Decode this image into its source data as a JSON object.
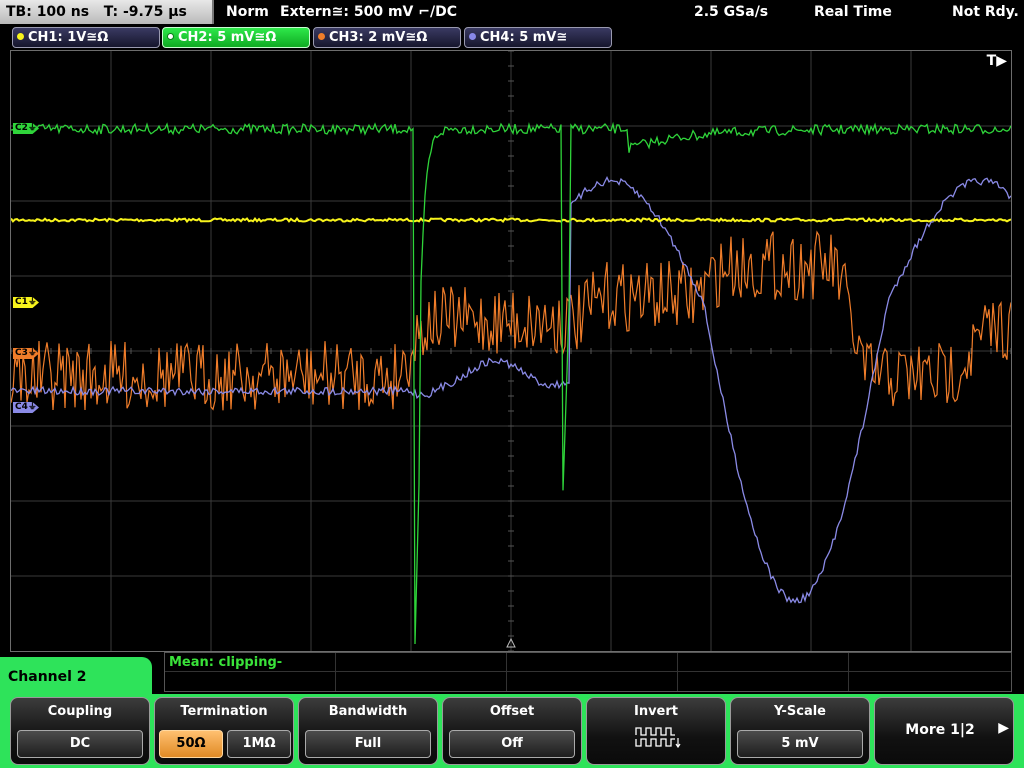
{
  "status": {
    "timebase": "TB: 100 ns   T: -9.75 µs",
    "trigger_mode": "Norm",
    "trigger_source": "Extern≅: 500 mV ⌐/DC",
    "sample_rate": "2.5 GSa/s",
    "acq_mode": "Real Time",
    "state": "Not Rdy."
  },
  "channels": [
    {
      "label": "CH1: 1V≅Ω",
      "color": "#f7f31c"
    },
    {
      "label": "CH2: 5 mV≅Ω",
      "color": "#34d23c",
      "active": true
    },
    {
      "label": "CH3: 2 mV≅Ω",
      "color": "#f07d2a"
    },
    {
      "label": "CH4: 5 mV≅",
      "color": "#8888e8"
    }
  ],
  "markers": {
    "c1": "C1⏚",
    "c2": "C2⏚",
    "c3": "C3⏚",
    "c4": "C4⏚"
  },
  "trigger_flag": "T▶",
  "measurement": {
    "text": "Mean: clipping-"
  },
  "menu": {
    "title": "Channel 2",
    "softkeys": [
      {
        "label": "Coupling",
        "value": "DC"
      },
      {
        "label": "Termination",
        "options": [
          "50Ω",
          "1MΩ"
        ],
        "selected": "50Ω"
      },
      {
        "label": "Bandwidth",
        "value": "Full"
      },
      {
        "label": "Offset",
        "value": "Off"
      },
      {
        "label": "Invert",
        "icon": "square-wave-invert-icon"
      },
      {
        "label": "Y-Scale",
        "value": "5 mV"
      }
    ],
    "more": "More 1|2"
  }
}
